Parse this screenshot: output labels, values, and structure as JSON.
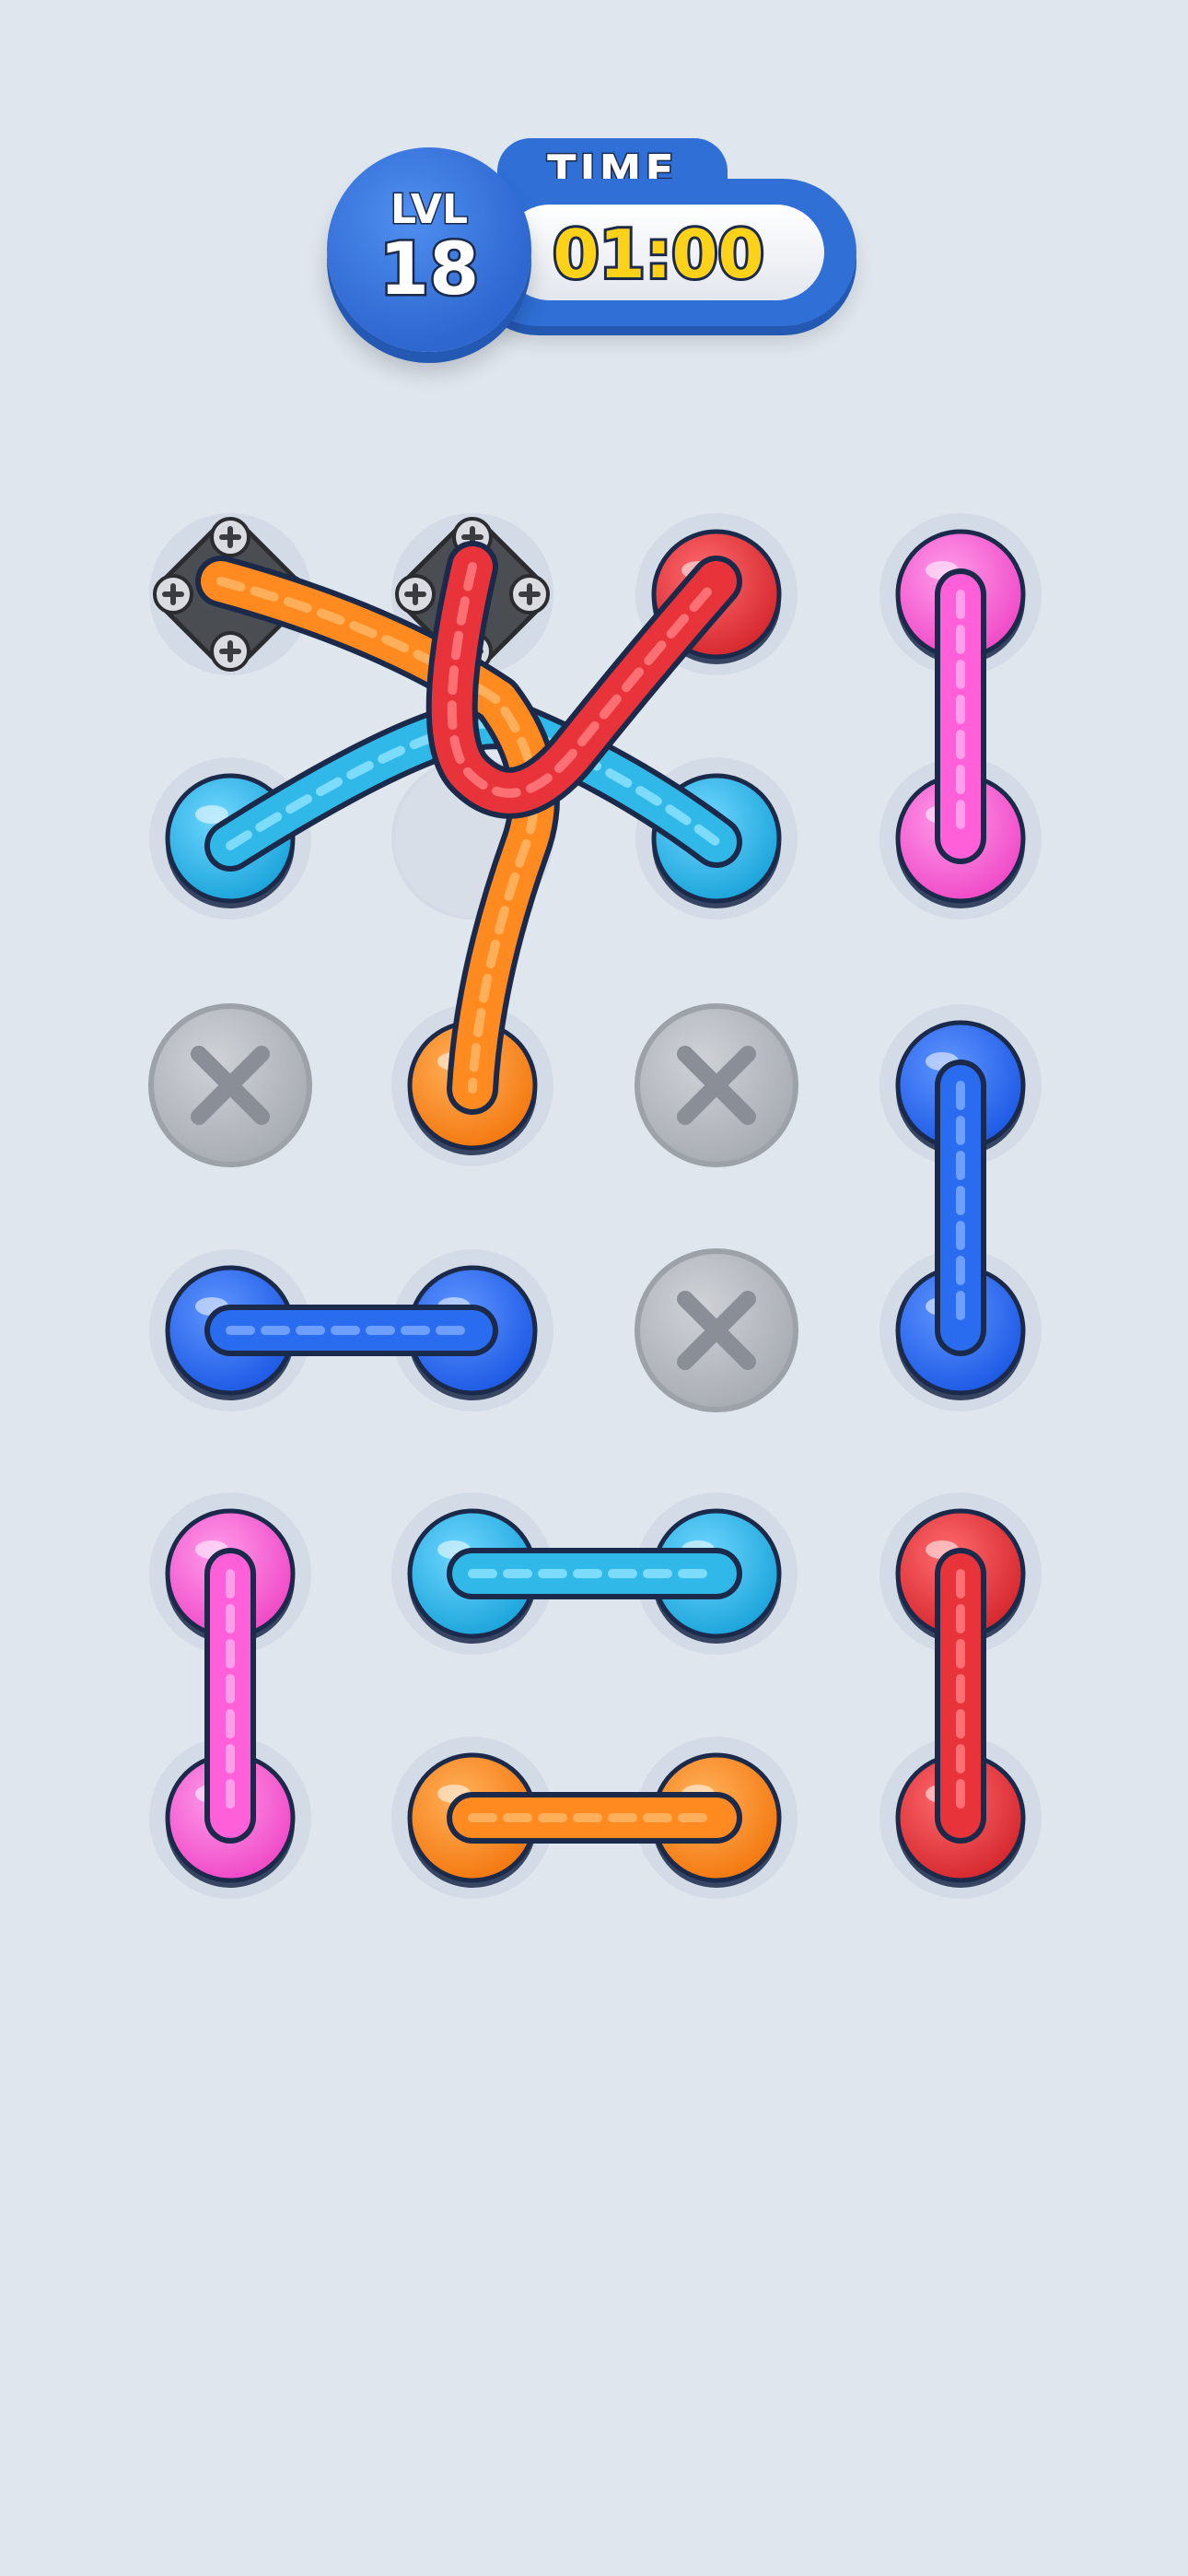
{
  "hud": {
    "level_label": "LVL",
    "level_number": "18",
    "time_label": "TIME",
    "time_value": "01:00"
  },
  "colors": {
    "background": "#dfe6ee",
    "orange": "#ff8a1f",
    "red": "#e8333a",
    "cyan": "#2fb8e8",
    "pink": "#ff5fd8",
    "blue": "#2a6cf0",
    "gray": "#b8bcc3",
    "screw_plate": "#4a4d52"
  },
  "board": {
    "columns": 4,
    "rows": 6,
    "pegs": [
      {
        "id": "peg-r0c0",
        "row": 0,
        "col": 0,
        "type": "screw-plate"
      },
      {
        "id": "peg-r0c1",
        "row": 0,
        "col": 1,
        "type": "screw-plate"
      },
      {
        "id": "peg-r0c2",
        "row": 0,
        "col": 2,
        "type": "knob",
        "color": "red"
      },
      {
        "id": "peg-r0c3",
        "row": 0,
        "col": 3,
        "type": "knob",
        "color": "pink"
      },
      {
        "id": "peg-r1c0",
        "row": 1,
        "col": 0,
        "type": "knob",
        "color": "cyan"
      },
      {
        "id": "peg-r1c1",
        "row": 1,
        "col": 1,
        "type": "empty"
      },
      {
        "id": "peg-r1c2",
        "row": 1,
        "col": 2,
        "type": "knob",
        "color": "cyan"
      },
      {
        "id": "peg-r1c3",
        "row": 1,
        "col": 3,
        "type": "knob",
        "color": "pink"
      },
      {
        "id": "peg-r2c0",
        "row": 2,
        "col": 0,
        "type": "blocked"
      },
      {
        "id": "peg-r2c1",
        "row": 2,
        "col": 1,
        "type": "knob",
        "color": "orange"
      },
      {
        "id": "peg-r2c2",
        "row": 2,
        "col": 2,
        "type": "blocked"
      },
      {
        "id": "peg-r2c3",
        "row": 2,
        "col": 3,
        "type": "knob",
        "color": "blue"
      },
      {
        "id": "peg-r3c0",
        "row": 3,
        "col": 0,
        "type": "knob",
        "color": "blue"
      },
      {
        "id": "peg-r3c1",
        "row": 3,
        "col": 1,
        "type": "knob",
        "color": "blue"
      },
      {
        "id": "peg-r3c2",
        "row": 3,
        "col": 2,
        "type": "blocked"
      },
      {
        "id": "peg-r3c3",
        "row": 3,
        "col": 3,
        "type": "knob",
        "color": "blue"
      },
      {
        "id": "peg-r4c0",
        "row": 4,
        "col": 0,
        "type": "knob",
        "color": "pink"
      },
      {
        "id": "peg-r4c1",
        "row": 4,
        "col": 1,
        "type": "knob",
        "color": "cyan"
      },
      {
        "id": "peg-r4c2",
        "row": 4,
        "col": 2,
        "type": "knob",
        "color": "cyan"
      },
      {
        "id": "peg-r4c3",
        "row": 4,
        "col": 3,
        "type": "knob",
        "color": "red"
      },
      {
        "id": "peg-r5c0",
        "row": 5,
        "col": 0,
        "type": "knob",
        "color": "pink"
      },
      {
        "id": "peg-r5c1",
        "row": 5,
        "col": 1,
        "type": "knob",
        "color": "orange"
      },
      {
        "id": "peg-r5c2",
        "row": 5,
        "col": 2,
        "type": "knob",
        "color": "orange"
      },
      {
        "id": "peg-r5c3",
        "row": 5,
        "col": 3,
        "type": "knob",
        "color": "red"
      }
    ],
    "ropes": [
      {
        "id": "rope-cyan-tangled",
        "color": "cyan",
        "from": "peg-r1c0",
        "to": "peg-r1c2",
        "tangled": true
      },
      {
        "id": "rope-orange-tangled",
        "color": "orange",
        "from": "peg-r0c0",
        "to": "peg-r2c1",
        "tangled": true
      },
      {
        "id": "rope-red-tangled",
        "color": "red",
        "from": "peg-r0c1",
        "to": "peg-r0c2",
        "tangled": true
      },
      {
        "id": "rope-pink-top",
        "color": "pink",
        "from": "peg-r0c3",
        "to": "peg-r1c3",
        "tangled": false
      },
      {
        "id": "rope-blue-right",
        "color": "blue",
        "from": "peg-r2c3",
        "to": "peg-r3c3",
        "tangled": false
      },
      {
        "id": "rope-blue-left",
        "color": "blue",
        "from": "peg-r3c0",
        "to": "peg-r3c1",
        "tangled": false
      },
      {
        "id": "rope-pink-bottom",
        "color": "pink",
        "from": "peg-r4c0",
        "to": "peg-r5c0",
        "tangled": false
      },
      {
        "id": "rope-cyan-bottom",
        "color": "cyan",
        "from": "peg-r4c1",
        "to": "peg-r4c2",
        "tangled": false
      },
      {
        "id": "rope-red-bottom",
        "color": "red",
        "from": "peg-r4c3",
        "to": "peg-r5c3",
        "tangled": false
      },
      {
        "id": "rope-orange-bottom",
        "color": "orange",
        "from": "peg-r5c1",
        "to": "peg-r5c2",
        "tangled": false
      }
    ]
  }
}
